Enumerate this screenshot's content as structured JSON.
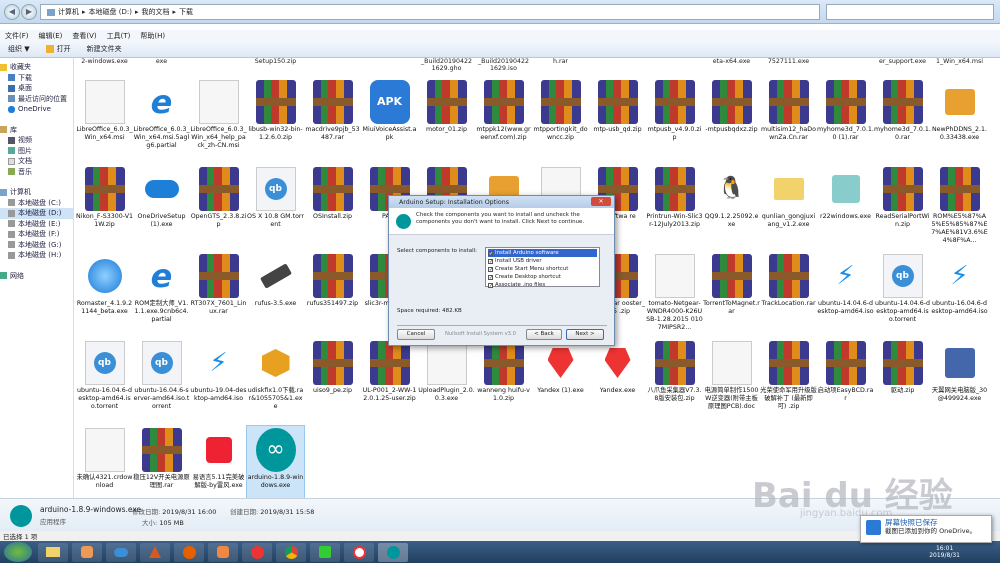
{
  "address": {
    "parts": [
      "计算机",
      "本地磁盘 (D:)",
      "我的文档",
      "下载"
    ]
  },
  "menu": [
    "文件(F)",
    "编辑(E)",
    "查看(V)",
    "工具(T)",
    "帮助(H)"
  ],
  "toolbar": {
    "organize": "组织 ▼",
    "open": "打开",
    "new_folder": "新建文件夹"
  },
  "nav": {
    "favorites": "收藏夹",
    "items": [
      "下载",
      "桌面",
      "最近访问的位置"
    ],
    "onedrive": "OneDrive",
    "libraries": "库",
    "lib_items": [
      "视频",
      "图片",
      "文档",
      "音乐"
    ],
    "computer": "计算机",
    "drives": [
      "本地磁盘 (C:)",
      "本地磁盘 (D:)",
      "本地磁盘 (E:)",
      "本地磁盘 (F:)",
      "本地磁盘 (G:)",
      "本地磁盘 (H:)"
    ],
    "network": "网络"
  },
  "top_labels": [
    "2-windows.exe",
    "exe",
    "",
    "Setup150.zip",
    "",
    "",
    "_Build20190422 1629.gho",
    "_Build20190422 1629.iso",
    "h.rar",
    "",
    "",
    "eta-x64.exe",
    "7527111.exe",
    "",
    "er_support.exe",
    "1_Win_x64.msi"
  ],
  "files": [
    {
      "icon": "msi",
      "name": "LibreOffice_6.0.3_Win_x64.msi"
    },
    {
      "icon": "ie",
      "name": "LibreOffice_6.0.3_Win_x64.msi.5aglg6.partial"
    },
    {
      "icon": "msi",
      "name": "LibreOffice_6.0.3_Win_x64_help_pack_zh-CN.msi"
    },
    {
      "icon": "zip",
      "name": "libusb-win32-bin-1.2.6.0.zip"
    },
    {
      "icon": "rar",
      "name": "macdrive9pjb_53487.rar"
    },
    {
      "icon": "apk",
      "name": "MiuiVoiceAssist.apk"
    },
    {
      "icon": "zip",
      "name": "motor_01.zip"
    },
    {
      "icon": "zip",
      "name": "mtppk12(www.greenxf.com).zip"
    },
    {
      "icon": "rar",
      "name": "mtpportingkit_downcc.zip"
    },
    {
      "icon": "zip",
      "name": "mtp-usb_qd.zip"
    },
    {
      "icon": "zip",
      "name": "mtpusb_v4.9.0.zip"
    },
    {
      "icon": "zip",
      "name": "-mtpusbqdxz.zip"
    },
    {
      "icon": "rar",
      "name": "multisim12_haDownZa.Cn.rar"
    },
    {
      "icon": "rar",
      "name": "myhome3d_7.0.1.0 (1).rar"
    },
    {
      "icon": "rar",
      "name": "myhome3d_7.0.1.0.rar"
    },
    {
      "icon": "box",
      "name": "NewPhDDNS_2.1.0.33438.exe"
    },
    {
      "icon": "rar",
      "name": "Nikon_F-S3300-V11W.zip"
    },
    {
      "icon": "cloud",
      "name": "OneDriveSetup (1).exe"
    },
    {
      "icon": "zip",
      "name": "OpenGTS_2.3.8.zip"
    },
    {
      "icon": "torrent",
      "name": "OS X 10.8 GM.torrent"
    },
    {
      "icon": "rar",
      "name": "OSInstall.zip"
    },
    {
      "icon": "rar",
      "name": "PAGr"
    },
    {
      "icon": "rar",
      "name": ""
    },
    {
      "icon": "box",
      "name": ""
    },
    {
      "icon": "exe",
      "name": ""
    },
    {
      "icon": "rar",
      "name": "C-Softwa re"
    },
    {
      "icon": "rar",
      "name": "Printrun-Win-Slic3r-12July2013.zip"
    },
    {
      "icon": "qq",
      "name": "QQ9.1.2.25092.exe"
    },
    {
      "icon": "folder",
      "name": "qunlian_gongjuxiang_v1.2.exe"
    },
    {
      "icon": "port",
      "name": "r22windows.exe"
    },
    {
      "icon": "rar",
      "name": "ReadSerialPortWin.zip"
    },
    {
      "icon": "rar",
      "name": "ROM%E5%87%A5%E5%85%87%E7%AE%81V3.6%E4%8F%A..."
    },
    {
      "icon": "blue",
      "name": "Romaster_4.1.9.21144_beta.exe"
    },
    {
      "icon": "ie",
      "name": "ROM定制大师_V1.1.1.exe.9cnb6c4.partial"
    },
    {
      "icon": "rar",
      "name": "RT307X_7601_Linux.rar"
    },
    {
      "icon": "usb",
      "name": "rufus-3.5.exe"
    },
    {
      "icon": "rar",
      "name": "rufus351497.zip"
    },
    {
      "icon": "rar",
      "name": "slic3r-m 6-1-2-9"
    },
    {
      "icon": "rar",
      "name": ""
    },
    {
      "icon": "rar",
      "name": ""
    },
    {
      "icon": "rar",
      "name": ""
    },
    {
      "icon": "rar",
      "name": "com.quar ooster_945 .zip"
    },
    {
      "icon": "exe",
      "name": "tomato-Netgear-WNDR4000-K26USB-1.28.2015 0107MIPSR2..."
    },
    {
      "icon": "rar",
      "name": "TorrentToMagnet.rar"
    },
    {
      "icon": "rar",
      "name": "TrackLocation.rar"
    },
    {
      "icon": "bolt",
      "name": "ubuntu-14.04.6-desktop-amd64.iso"
    },
    {
      "icon": "torrent",
      "name": "ubuntu-14.04.6-desktop-amd64.iso.torrent"
    },
    {
      "icon": "bolt",
      "name": "ubuntu-16.04.6-desktop-amd64.iso"
    },
    {
      "icon": "torrent",
      "name": "ubuntu-16.04.6-desktop-amd64.iso.torrent"
    },
    {
      "icon": "torrent",
      "name": "ubuntu-16.04.6-server-amd64.iso.torrent"
    },
    {
      "icon": "bolt",
      "name": "ubuntu-19.04-desktop-amd64.iso"
    },
    {
      "icon": "orange",
      "name": "udiskfix1.0下载.rar&1055705&1.exe"
    },
    {
      "icon": "rar",
      "name": "uiso9_pe.zip"
    },
    {
      "icon": "rar",
      "name": "UL-P001_2-WW-12.0.1.25-user.zip"
    },
    {
      "icon": "exe",
      "name": "UploadPlugin_2.0.0.3.exe"
    },
    {
      "icon": "rar",
      "name": "wanneng huifu-v1.0.zip"
    },
    {
      "icon": "yandex",
      "name": "Yandex (1).exe"
    },
    {
      "icon": "yandex",
      "name": "Yandex.exe"
    },
    {
      "icon": "rar",
      "name": "八爪鱼采集器V7.3.8版安装包.zip"
    },
    {
      "icon": "doc",
      "name": "电源简单制作1500W逆变器(附带主板原理图PCB).doc"
    },
    {
      "icon": "rar",
      "name": "光荣使命军用升级版破解补丁 (最新即可) .zip"
    },
    {
      "icon": "rar",
      "name": "启动项EasyBCD.rar"
    },
    {
      "icon": "rar",
      "name": "驱动.zip"
    },
    {
      "icon": "reg",
      "name": "天翼网关电脑版_30@499924.exe"
    },
    {
      "icon": "crdl",
      "name": "未确认4321.crdownload"
    },
    {
      "icon": "rar",
      "name": "稳压12V开关电源原理图.rar"
    },
    {
      "icon": "lamp",
      "name": "易语言5.11完美破解版-by雷风.exe"
    },
    {
      "icon": "arduino",
      "name": "arduino-1.8.9-windows.exe"
    }
  ],
  "dialog": {
    "title": "Arduino Setup: Installation Options",
    "close": "✕",
    "header_text": "Check the components you want to install and uncheck the components you don't want to install. Click Next to continue.",
    "select_label": "Select components to install:",
    "components": [
      "Install Arduino software",
      "Install USB driver",
      "Create Start Menu shortcut",
      "Create Desktop shortcut",
      "Associate .ino files"
    ],
    "space_label": "Space required: 482.",
    "space_unit": "KB",
    "cancel": "Cancel",
    "nsis": "Nullsoft Install System v3.0",
    "back": "< Back",
    "next": "Next >"
  },
  "details": {
    "name": "arduino-1.8.9-windows.exe",
    "modified_label": "修改日期:",
    "modified": "2019/8/31 16:00",
    "created_label": "创建日期:",
    "created": "2019/8/31 15:58",
    "type": "应用程序",
    "size_label": "大小:",
    "size": "105 MB"
  },
  "status_line": "已选择 1 项",
  "toast": {
    "title": "屏幕快照已保存",
    "body": "截图已添加到你的 OneDrive。"
  },
  "watermark": {
    "main": "Bai du 经验",
    "sub": "jingyan.baidu.com"
  },
  "tray": {
    "time": "16:01",
    "date": "2019/8/31"
  },
  "taskbar_apps": [
    "folder",
    "media",
    "baidu",
    "matlab",
    "firefox",
    "arrow",
    "weibo",
    "chrome",
    "m",
    "yandex",
    "arduino"
  ]
}
